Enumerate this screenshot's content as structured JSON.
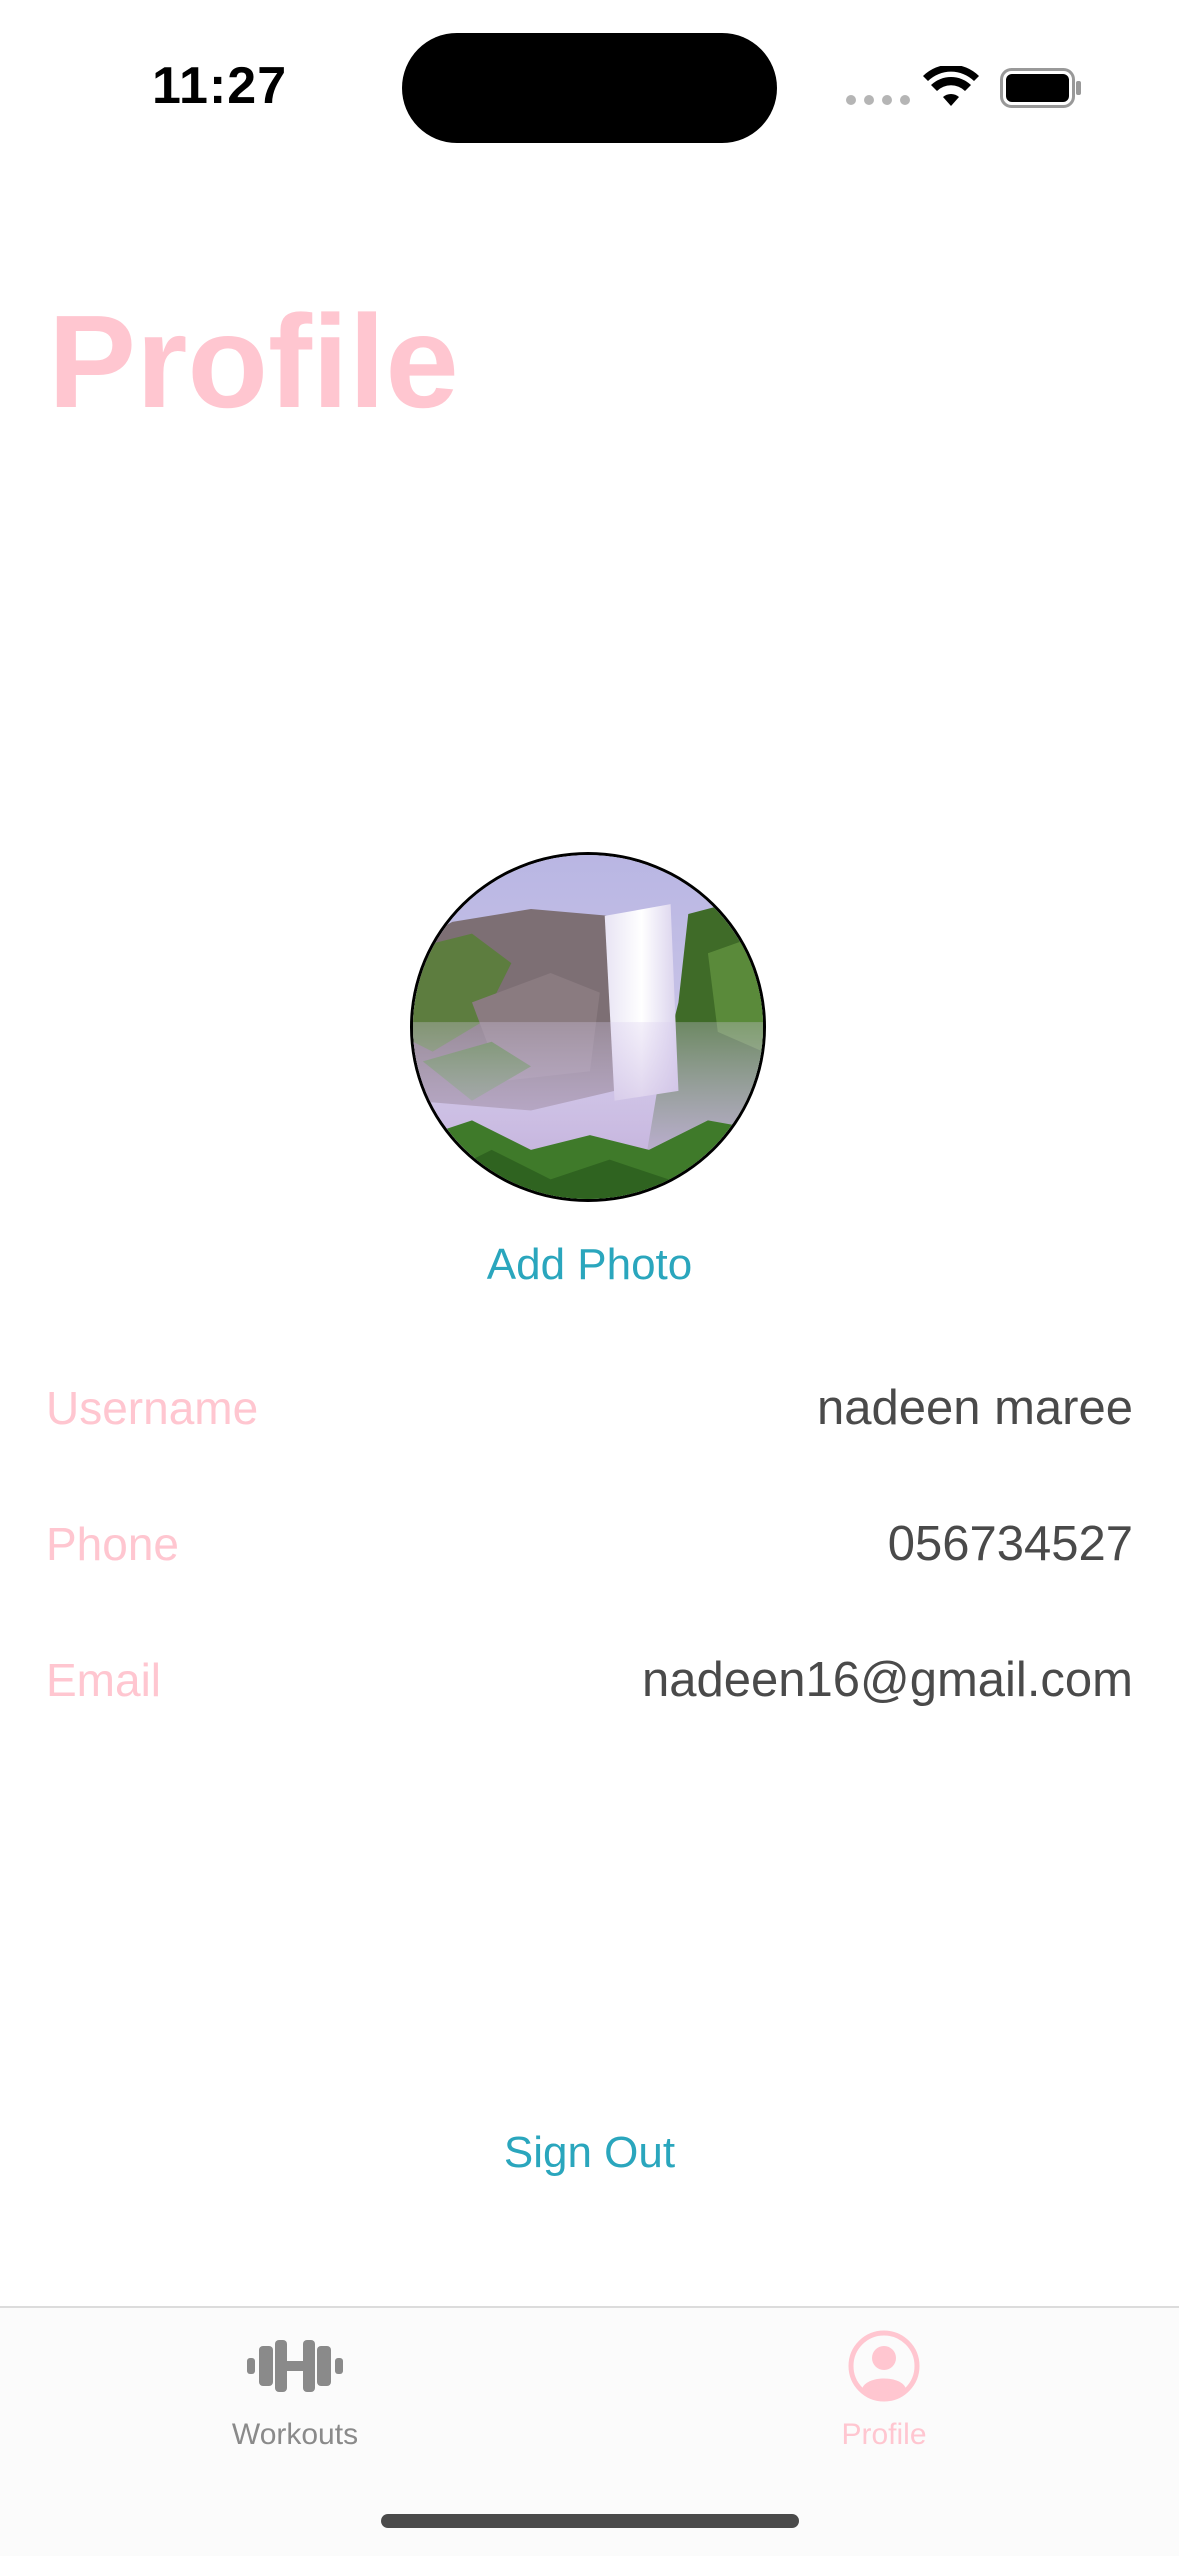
{
  "status_bar": {
    "time": "11:27",
    "icons": [
      "signal-dots-icon",
      "wifi-icon",
      "battery-icon"
    ]
  },
  "header": {
    "title": "Profile"
  },
  "avatar": {
    "image": "waterfall-photo",
    "add_photo_label": "Add Photo"
  },
  "profile_fields": [
    {
      "label": "Username",
      "value": "nadeen maree"
    },
    {
      "label": "Phone",
      "value": "056734527"
    },
    {
      "label": "Email",
      "value": "nadeen16@gmail.com"
    }
  ],
  "actions": {
    "sign_out_label": "Sign Out"
  },
  "tab_bar": {
    "tabs": [
      {
        "label": "Workouts",
        "icon": "dumbbell-icon",
        "selected": false
      },
      {
        "label": "Profile",
        "icon": "person-circle-icon",
        "selected": true
      }
    ]
  },
  "colors": {
    "accent_pink": "#ffc6d0",
    "link_teal": "#2aa6bd",
    "value_gray": "#4a4a4a",
    "inactive_gray": "#8a8a8a"
  }
}
